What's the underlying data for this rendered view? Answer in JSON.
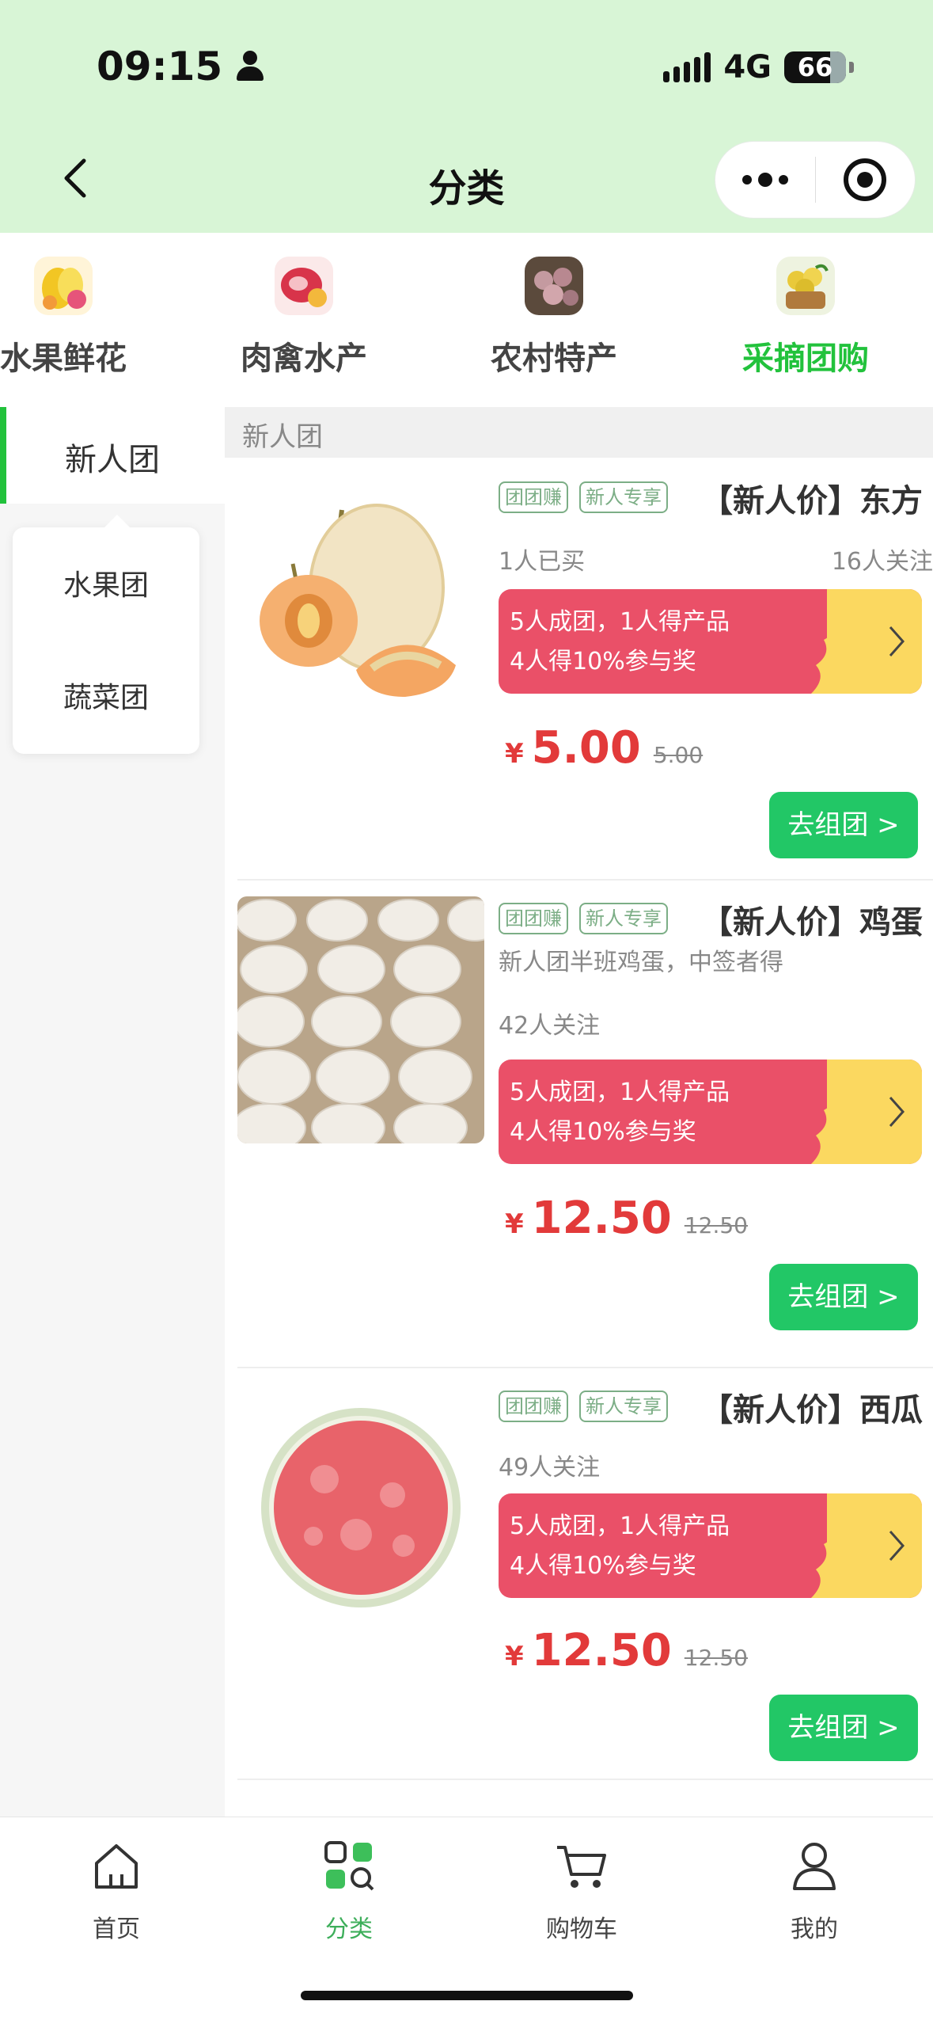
{
  "status_bar": {
    "time": "09:15",
    "network": "4G",
    "battery": "66"
  },
  "header": {
    "title": "分类"
  },
  "categories": [
    {
      "label": "水果鲜花",
      "icon": "fruit-flower-thumbnail",
      "active": false
    },
    {
      "label": "肉禽水产",
      "icon": "meat-thumbnail",
      "active": false
    },
    {
      "label": "农村特产",
      "icon": "specialty-thumbnail",
      "active": false
    },
    {
      "label": "采摘团购",
      "icon": "picking-thumbnail",
      "active": true
    }
  ],
  "sidebar": {
    "active": "新人团",
    "options": [
      "水果团",
      "蔬菜团"
    ]
  },
  "section_title": "新人团",
  "products": [
    {
      "tags": [
        "团团赚",
        "新人专享"
      ],
      "title": "【新人价】东方",
      "sub_left": "1人已买",
      "sub_right": "16人关注",
      "banner_line1": "5人成团，1人得产品",
      "banner_line2": "4人得10%参与奖",
      "currency": "¥",
      "price": "5.00",
      "original_price": "5.00",
      "button": "去组团 >",
      "image": "melon-photo"
    },
    {
      "tags": [
        "团团赚",
        "新人专享"
      ],
      "title": "【新人价】鸡蛋",
      "description": "新人团半班鸡蛋，中签者得",
      "sub_left": "42人关注",
      "banner_line1": "5人成团，1人得产品",
      "banner_line2": "4人得10%参与奖",
      "currency": "¥",
      "price": "12.50",
      "original_price": "12.50",
      "button": "去组团 >",
      "image": "eggs-photo"
    },
    {
      "tags": [
        "团团赚",
        "新人专享"
      ],
      "title": "【新人价】西瓜",
      "sub_left": "49人关注",
      "banner_line1": "5人成团，1人得产品",
      "banner_line2": "4人得10%参与奖",
      "currency": "¥",
      "price": "12.50",
      "original_price": "12.50",
      "button": "去组团 >",
      "image": "watermelon-photo"
    }
  ],
  "tabbar": [
    {
      "label": "首页",
      "icon": "home-icon",
      "active": false
    },
    {
      "label": "分类",
      "icon": "category-icon",
      "active": true
    },
    {
      "label": "购物车",
      "icon": "cart-icon",
      "active": false
    },
    {
      "label": "我的",
      "icon": "profile-icon",
      "active": false
    }
  ],
  "colors": {
    "header_bg": "#d8f5d6",
    "accent_green": "#22c23c",
    "price_red": "#e23a3a",
    "banner_red": "#ea5068",
    "banner_yellow": "#fbd860",
    "button_green": "#22c766"
  }
}
